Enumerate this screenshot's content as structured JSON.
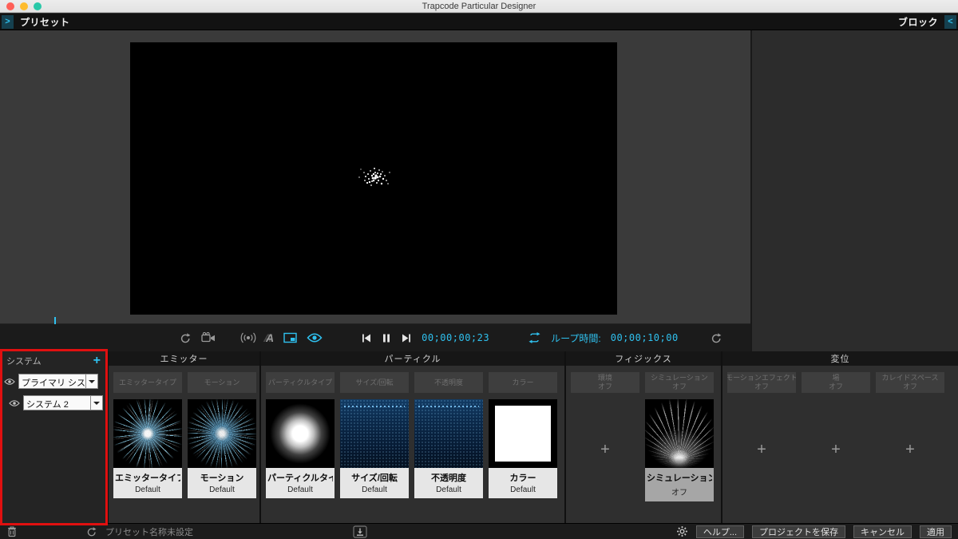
{
  "window": {
    "title": "Trapcode Particular Designer"
  },
  "topbar": {
    "presets_label": "プリセット",
    "blocks_label": "ブロック"
  },
  "icons": {
    "plus": "+",
    "chevron_right": ">",
    "chevron_left": "<",
    "motion_blur": "A"
  },
  "toolbar": {
    "timecode": "00;00;00;23",
    "loop_label": "ループ時間:",
    "loop_time": "00;00;10;00"
  },
  "system": {
    "title": "システム",
    "items": [
      {
        "name": "プライマリ システム"
      },
      {
        "name": "システム 2"
      }
    ]
  },
  "sections": [
    {
      "title": "エミッター",
      "columns": [
        {
          "tab": {
            "t1": "エミッタータイプ",
            "t2": ""
          },
          "card": {
            "title": "エミッタータイプ",
            "subtitle": "Default"
          }
        },
        {
          "tab": {
            "t1": "モーション",
            "t2": ""
          },
          "card": {
            "title": "モーション",
            "subtitle": "Default"
          }
        }
      ]
    },
    {
      "title": "パーティクル",
      "columns": [
        {
          "tab": {
            "t1": "パーティクルタイプ",
            "t2": ""
          },
          "card": {
            "title": "パーティクルタイプ",
            "subtitle": "Default"
          }
        },
        {
          "tab": {
            "t1": "サイズ/回転",
            "t2": ""
          },
          "card": {
            "title": "サイズ/回転",
            "subtitle": "Default"
          }
        },
        {
          "tab": {
            "t1": "不透明度",
            "t2": ""
          },
          "card": {
            "title": "不透明度",
            "subtitle": "Default"
          }
        },
        {
          "tab": {
            "t1": "カラー",
            "t2": ""
          },
          "card": {
            "title": "カラー",
            "subtitle": "Default"
          }
        }
      ]
    },
    {
      "title": "フィジックス",
      "columns": [
        {
          "tab": {
            "t1": "環境",
            "t2": "オフ"
          }
        },
        {
          "tab": {
            "t1": "シミュレーション",
            "t2": "オフ"
          },
          "card": {
            "title": "シミュレーション",
            "subtitle": "オフ"
          }
        }
      ]
    },
    {
      "title": "変位",
      "columns": [
        {
          "tab": {
            "t1": "モーションエフェクト",
            "t2": "オフ"
          }
        },
        {
          "tab": {
            "t1": "場",
            "t2": "オフ"
          }
        },
        {
          "tab": {
            "t1": "カレイドスペース",
            "t2": "オフ"
          }
        }
      ]
    }
  ],
  "bottom": {
    "preset_name": "プリセット名称未設定",
    "help": "ヘルプ...",
    "save": "プロジェクトを保存",
    "cancel": "キャンセル",
    "apply": "適用"
  },
  "colors": {
    "accent": "#2fc1ef",
    "annotation": "#e01010"
  }
}
